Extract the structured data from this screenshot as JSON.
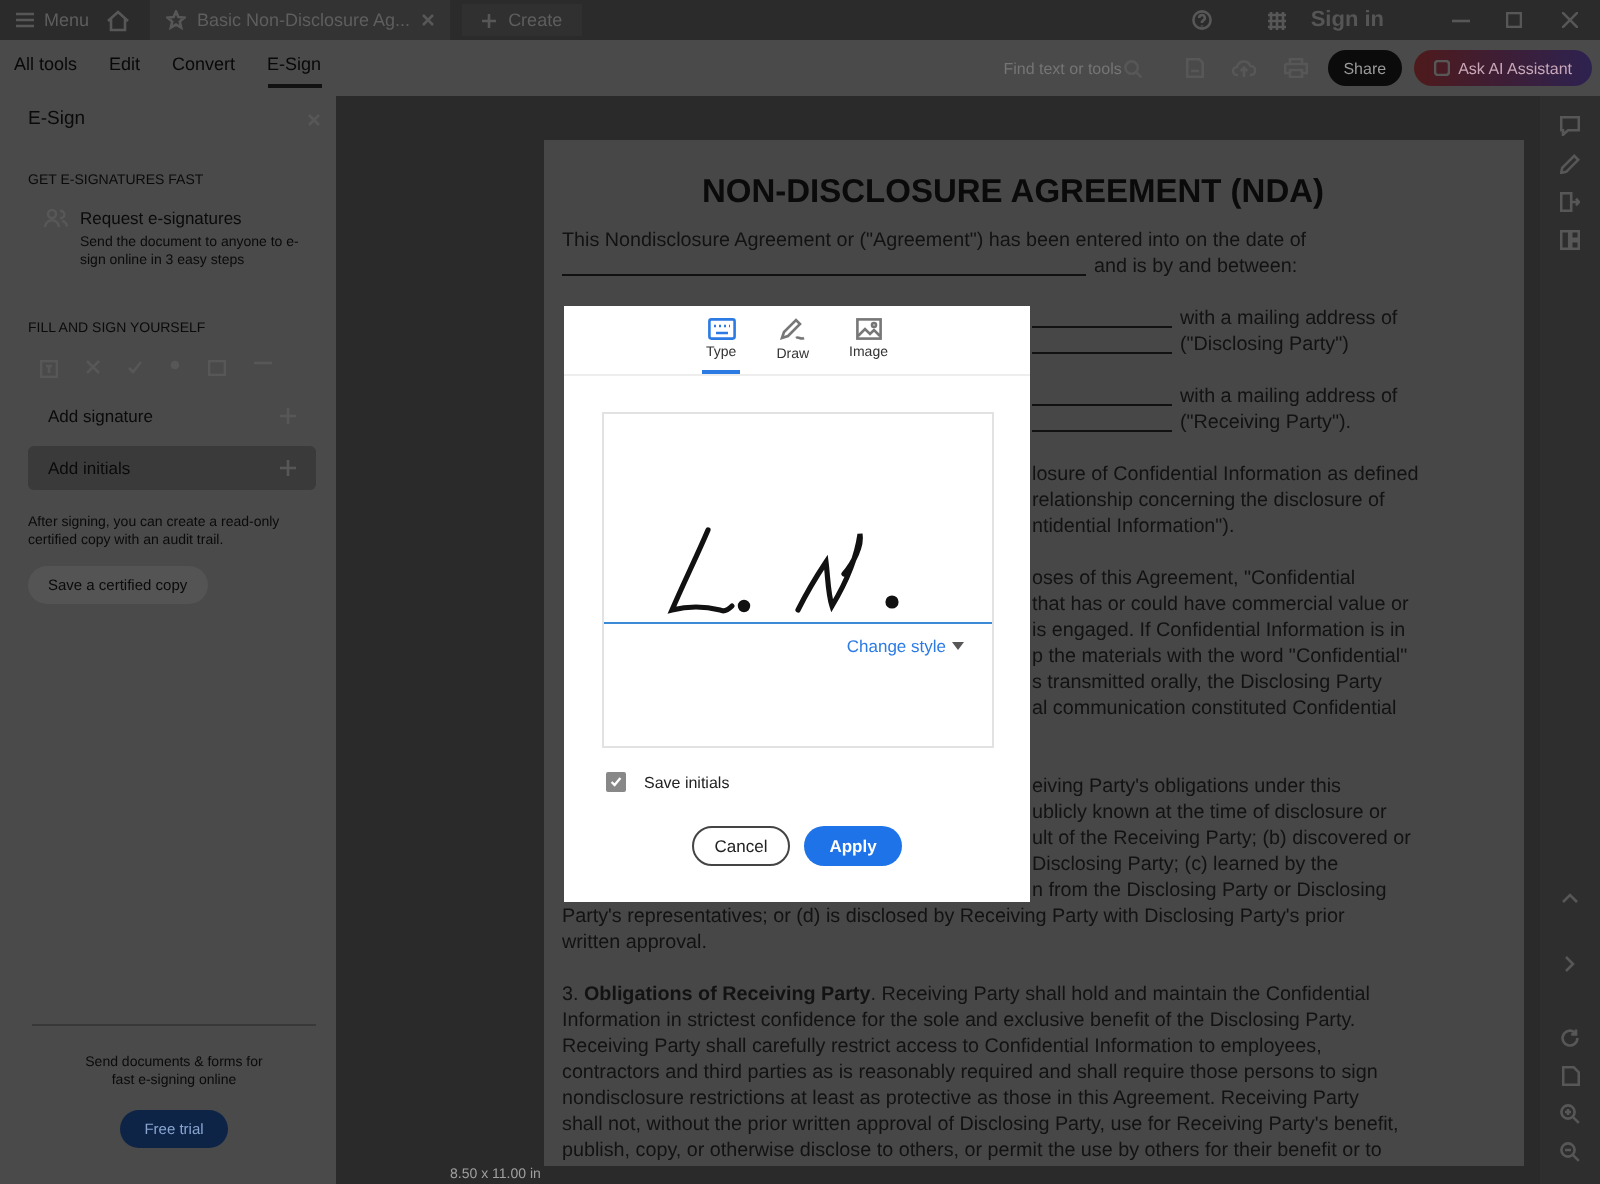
{
  "title_bar": {
    "menu": "Menu",
    "tab": {
      "title": "Basic Non-Disclosure Ag..."
    },
    "create": "Create",
    "sign_in": "Sign in"
  },
  "toolbar": {
    "tabs": [
      {
        "label": "All tools",
        "selected": false
      },
      {
        "label": "Edit",
        "selected": false
      },
      {
        "label": "Convert",
        "selected": false
      },
      {
        "label": "E-Sign",
        "selected": true
      }
    ],
    "search": {
      "placeholder": "Find text or tools"
    },
    "share": "Share",
    "ai_assistant": "Ask AI Assistant"
  },
  "panel": {
    "title": "E-Sign",
    "section_1": "GET E-SIGNATURES FAST",
    "request": {
      "title": "Request e-signatures",
      "description": "Send the document to anyone to e-sign online in 3 easy steps"
    },
    "section_2": "FILL AND SIGN YOURSELF",
    "items": [
      {
        "label": "Add signature",
        "selected": false
      },
      {
        "label": "Add initials",
        "selected": true
      }
    ],
    "note": "After signing, you can create a read-only certified copy with an audit trail.",
    "certify_button": "Save a certified copy",
    "promo": "Send documents & forms for fast e-signing online",
    "trial_button": "Free trial"
  },
  "document": {
    "title": "NON-DISCLOSURE AGREEMENT (NDA)",
    "paragraphs": [
      [
        {
          "kind": "full",
          "text": "This Nondisclosure Agreement or (\"Agreement\") has been entered into on the date of"
        },
        {
          "kind": "blank",
          "text": "and is by and between:"
        }
      ],
      [
        {
          "kind": "partial_blank",
          "text": "with a mailing address of"
        },
        {
          "kind": "partial_blank",
          "text": "(\"Disclosing Party\")"
        }
      ],
      [
        {
          "kind": "partial_blank",
          "text": "with a mailing address of"
        },
        {
          "kind": "partial_blank",
          "text": "(\"Receiving Party\")."
        }
      ],
      [
        {
          "kind": "partial",
          "text": "losure of Confidential Information as defined"
        },
        {
          "kind": "partial",
          "text": "relationship concerning the disclosure of"
        },
        {
          "kind": "partial",
          "text": "ntidential Information\")."
        }
      ],
      [
        {
          "kind": "partial",
          "text": "oses of this Agreement, \"Confidential"
        },
        {
          "kind": "partial",
          "text": "that has or could have commercial value or"
        },
        {
          "kind": "partial",
          "text": "is engaged. If Confidential Information is in"
        },
        {
          "kind": "partial",
          "text": "p the materials with the word \"Confidential\""
        },
        {
          "kind": "partial",
          "text": "s transmitted orally, the Disclosing Party"
        },
        {
          "kind": "partial",
          "text": "al communication constituted Confidential"
        }
      ],
      [
        {
          "kind": "covered"
        },
        {
          "kind": "partial",
          "text": "eiving Party's obligations under this"
        },
        {
          "kind": "partial",
          "text": "ublicly known at the time of disclosure or"
        },
        {
          "kind": "partial",
          "text": "ult of the Receiving Party; (b) discovered or"
        },
        {
          "kind": "partial",
          "text": "Disclosing Party; (c) learned by the"
        },
        {
          "kind": "partial",
          "text": "n from the Disclosing Party or Disclosing"
        },
        {
          "kind": "full",
          "text": "Party's representatives; or (d) is disclosed by Receiving Party with Disclosing Party's prior"
        },
        {
          "kind": "full",
          "text": "written approval."
        }
      ],
      [
        {
          "kind": "full",
          "text": "3. **Obligations of Receiving Party**. Receiving Party shall hold and maintain the Confidential"
        },
        {
          "kind": "full",
          "text": "Information in strictest confidence for the sole and exclusive benefit of the Disclosing Party."
        },
        {
          "kind": "full",
          "text": "Receiving Party shall carefully restrict access to Confidential Information to employees,"
        },
        {
          "kind": "full",
          "text": "contractors and third parties as is reasonably required and shall require those persons to sign"
        },
        {
          "kind": "full",
          "text": "nondisclosure restrictions at least as protective as those in this Agreement. Receiving Party"
        },
        {
          "kind": "full",
          "text": "shall not, without the prior written approval of Disclosing Party, use for Receiving Party's benefit,"
        },
        {
          "kind": "full",
          "text": "publish, copy, or otherwise disclose to others, or permit the use by others for their benefit or to"
        }
      ]
    ]
  },
  "status": "8.50 x 11.00 in",
  "dialog": {
    "tabs": [
      {
        "label": "Type",
        "kind": "type",
        "selected": true
      },
      {
        "label": "Draw",
        "kind": "draw",
        "selected": false
      },
      {
        "label": "Image",
        "kind": "image",
        "selected": false
      }
    ],
    "change_style": "Change style",
    "save_initials": {
      "label": "Save initials",
      "checked": true
    },
    "buttons": [
      {
        "label": "Cancel",
        "kind": "secondary"
      },
      {
        "label": "Apply",
        "kind": "primary"
      }
    ]
  }
}
